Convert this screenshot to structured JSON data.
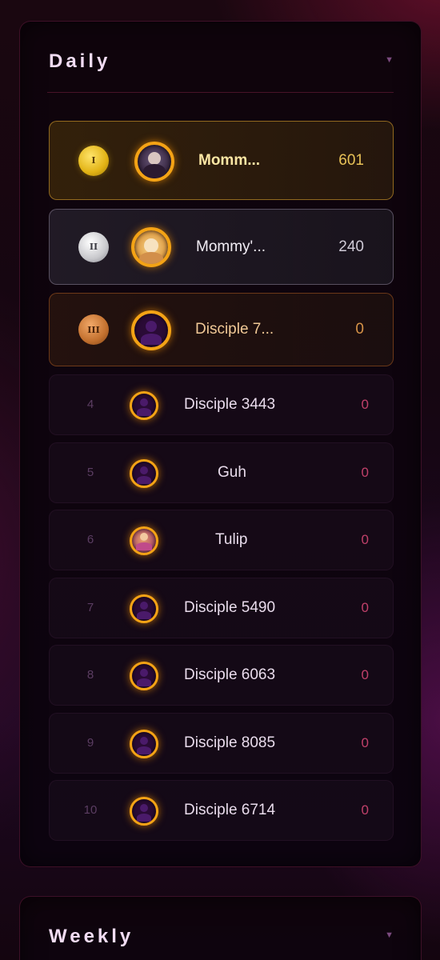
{
  "daily": {
    "title": "Daily",
    "chevron": "▼",
    "entries": [
      {
        "rank": "I",
        "name": "Momm...",
        "score": "601"
      },
      {
        "rank": "II",
        "name": "Mommy'...",
        "score": "240"
      },
      {
        "rank": "III",
        "name": "Disciple 7...",
        "score": "0"
      },
      {
        "rank": "4",
        "name": "Disciple 3443",
        "score": "0"
      },
      {
        "rank": "5",
        "name": "Guh",
        "score": "0"
      },
      {
        "rank": "6",
        "name": "Tulip",
        "score": "0"
      },
      {
        "rank": "7",
        "name": "Disciple 5490",
        "score": "0"
      },
      {
        "rank": "8",
        "name": "Disciple 6063",
        "score": "0"
      },
      {
        "rank": "9",
        "name": "Disciple 8085",
        "score": "0"
      },
      {
        "rank": "10",
        "name": "Disciple 6714",
        "score": "0"
      }
    ]
  },
  "weekly": {
    "title": "Weekly",
    "chevron": "▼"
  },
  "colors": {
    "gold": "#e2b315",
    "silver": "#c8c8cc",
    "bronze": "#c2702e",
    "avatar_ring": "#f4a315",
    "score_zero": "#c0406a"
  }
}
